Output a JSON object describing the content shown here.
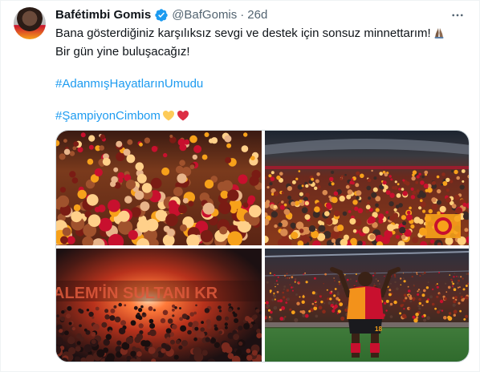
{
  "tweet": {
    "author_name": "Bafétimbi Gomis",
    "handle": "@BafGomis",
    "separator": "·",
    "time": "26d",
    "more_icon": "more-horizontal-icon",
    "verified_icon": "verified-badge-icon",
    "lines": [
      "Bana gösterdiğiniz karşılıksız sevgi ve destek için sonsuz minnettarım!",
      "Bir gün yine buluşacağız!"
    ],
    "hashtags": [
      "#AdanmışHayatlarınUmudu",
      "#ŞampiyonCimbom"
    ],
    "emojis": [
      "praying-hands-emoji",
      "yellow-heart-emoji",
      "red-heart-emoji"
    ],
    "media": [
      {
        "name": "photo-fans-cheering"
      },
      {
        "name": "photo-stadium-crowd"
      },
      {
        "name": "photo-flare-stand",
        "banner_text": "ALEM'İN SULTANI KR"
      },
      {
        "name": "photo-player-celebrating",
        "shirt_number": "18"
      }
    ],
    "colors": {
      "link": "#1d9bf0",
      "verified": "#1d9bf0",
      "secondary": "#536471",
      "galatasaray_red": "#c8102e",
      "galatasaray_yellow": "#f7a11a"
    }
  }
}
